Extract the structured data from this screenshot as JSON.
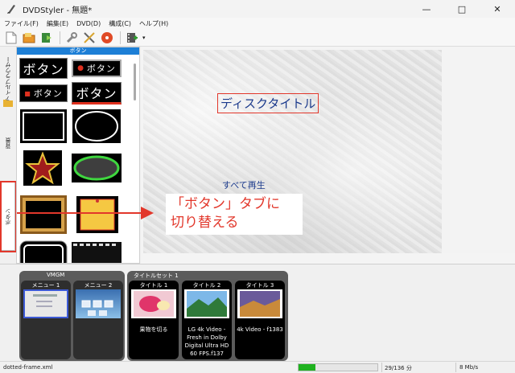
{
  "window": {
    "title": "DVDStyler - 無題*",
    "minimize": "—",
    "maximize": "□",
    "close": "✕"
  },
  "menu": [
    "ファイル(F)",
    "編集(E)",
    "DVD(D)",
    "構成(C)",
    "ヘルプ(H)"
  ],
  "toolbar": {
    "icons": [
      "new-project-icon",
      "open-folder-icon",
      "add-file-icon",
      "settings-wrench-icon",
      "tools-icon",
      "burn-disc-icon",
      "add-video-icon"
    ]
  },
  "left_tabs": {
    "file_browser": "ファイルブラウザー",
    "backgrounds": "背景",
    "buttons": "ボタン"
  },
  "panel": {
    "header": "ボタン",
    "button_text": "ボタン"
  },
  "canvas": {
    "disc_title": "ディスクタイトル",
    "play_all": "すべて再生"
  },
  "annotation": {
    "line1": "「ボタン」タブに",
    "line2": "切り替える",
    "color": "#e2372b"
  },
  "vmgm": {
    "label": "VMGM",
    "menus": [
      {
        "label": "メニュー 1"
      },
      {
        "label": "メニュー 2"
      }
    ]
  },
  "titleset": {
    "label": "タイトルセット 1",
    "titles": [
      {
        "label": "タイトル 1",
        "text": "果物を切る"
      },
      {
        "label": "タイトル 2",
        "text": "LG 4k Video - Fresh in Dolby Digital Ultra HD 60 FPS.f137"
      },
      {
        "label": "タイトル 3",
        "text": "4k Video - f1383"
      }
    ]
  },
  "status": {
    "file": "dotted-frame.xml",
    "progress_fraction": 0.21,
    "count": "29/136 分",
    "rate": "8 Mb/s"
  }
}
